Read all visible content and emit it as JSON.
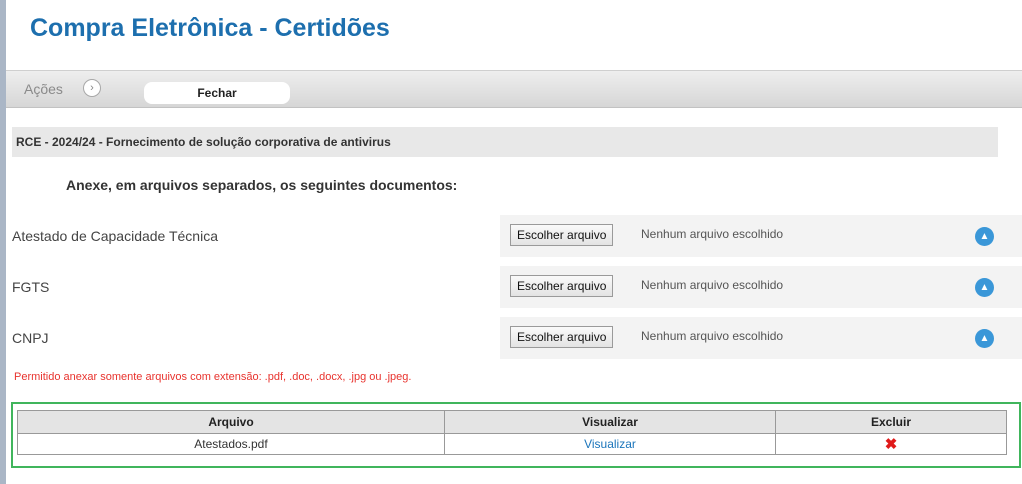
{
  "title": "Compra Eletrônica - Certidões",
  "actions": {
    "label": "Ações",
    "close_button": "Fechar"
  },
  "header_bar": "RCE - 2024/24 - Fornecimento de solução corporativa de antivirus",
  "instructions": "Anexe, em arquivos separados, os seguintes documentos:",
  "documents": [
    {
      "label": "Atestado de Capacidade Técnica",
      "button": "Escolher arquivo",
      "status": "Nenhum arquivo escolhido"
    },
    {
      "label": "FGTS",
      "button": "Escolher arquivo",
      "status": "Nenhum arquivo escolhido"
    },
    {
      "label": "CNPJ",
      "button": "Escolher arquivo",
      "status": "Nenhum arquivo escolhido"
    }
  ],
  "permission_note": "Permitido anexar somente arquivos com extensão: .pdf, .doc, .docx, .jpg ou .jpeg.",
  "attachments_table": {
    "headers": [
      "Arquivo",
      "Visualizar",
      "Excluir"
    ],
    "rows": [
      {
        "file": "Atestados.pdf",
        "view": "Visualizar",
        "delete_icon": "✖"
      }
    ]
  },
  "colors": {
    "title": "#1d6fae",
    "link": "#1b75bb",
    "warning": "#e8332e",
    "box_border": "#40b55c",
    "upload_icon": "#3a97d8"
  }
}
